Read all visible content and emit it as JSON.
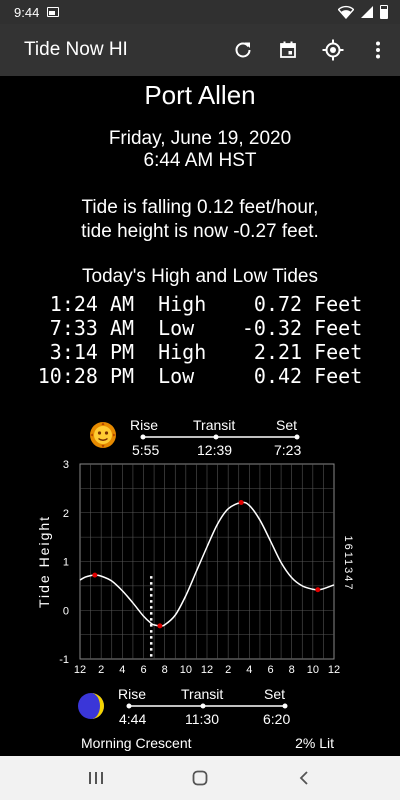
{
  "status_bar": {
    "time": "9:44",
    "battery_icon": "battery-icon",
    "wifi_icon": "wifi-icon"
  },
  "app_bar": {
    "title": "Tide Now HI",
    "actions": [
      "refresh-icon",
      "calendar-icon",
      "location-icon",
      "more-vert-icon"
    ]
  },
  "location": "Port Allen",
  "date": "Friday, June 19, 2020",
  "time": "6:44 AM HST",
  "tide_status": {
    "line1": "Tide is falling 0.12 feet/hour,",
    "line2": "tide height is now -0.27 feet."
  },
  "tides_header": "Today's High and Low Tides",
  "tides": [
    {
      "time": "1:24 AM",
      "type": "High",
      "height": "0.72",
      "unit": "Feet"
    },
    {
      "time": "7:33 AM",
      "type": "Low",
      "height": "-0.32",
      "unit": "Feet"
    },
    {
      "time": "3:14 PM",
      "type": "High",
      "height": "2.21",
      "unit": "Feet"
    },
    {
      "time": "10:28 PM",
      "type": "Low",
      "height": "0.42",
      "unit": "Feet"
    }
  ],
  "sun": {
    "icon": "sun-icon",
    "rise_label": "Rise",
    "transit_label": "Transit",
    "set_label": "Set",
    "rise": "5:55",
    "transit": "12:39",
    "set": "7:23"
  },
  "moon": {
    "icon": "moon-icon",
    "rise_label": "Rise",
    "transit_label": "Transit",
    "set_label": "Set",
    "rise": "4:44",
    "transit": "11:30",
    "set": "6:20",
    "phase": "Morning Crescent",
    "lit": "2% Lit"
  },
  "chart_data": {
    "type": "line",
    "ylabel": "Tide Height",
    "station_label": "1611347",
    "xlim": [
      0,
      24
    ],
    "ylim": [
      -1,
      3
    ],
    "x_tick_labels": [
      "12",
      "2",
      "4",
      "6",
      "8",
      "10",
      "12",
      "2",
      "4",
      "6",
      "8",
      "10",
      "12"
    ],
    "y_tick_labels": [
      "-1",
      "0",
      "1",
      "2",
      "3"
    ],
    "grid": true,
    "current_time": 6.73,
    "series": [
      {
        "x": [
          0,
          0.5,
          1,
          1.4,
          2,
          3,
          4,
          5,
          6,
          6.73,
          7,
          7.55,
          8,
          9,
          10,
          11,
          12,
          13,
          14,
          15.23,
          16,
          17,
          18,
          19,
          20,
          21,
          22,
          22.47,
          23,
          24
        ],
        "values": [
          0.62,
          0.68,
          0.71,
          0.72,
          0.7,
          0.6,
          0.4,
          0.15,
          -0.12,
          -0.27,
          -0.3,
          -0.32,
          -0.3,
          -0.1,
          0.3,
          0.8,
          1.3,
          1.77,
          2.08,
          2.21,
          2.15,
          1.85,
          1.42,
          0.98,
          0.67,
          0.5,
          0.43,
          0.42,
          0.44,
          0.52
        ]
      }
    ],
    "extrema": [
      {
        "x": 1.4,
        "y": 0.72
      },
      {
        "x": 7.55,
        "y": -0.32
      },
      {
        "x": 15.23,
        "y": 2.21
      },
      {
        "x": 22.47,
        "y": 0.42
      }
    ]
  },
  "nav_bar": [
    "recents-icon",
    "home-icon",
    "back-icon"
  ]
}
